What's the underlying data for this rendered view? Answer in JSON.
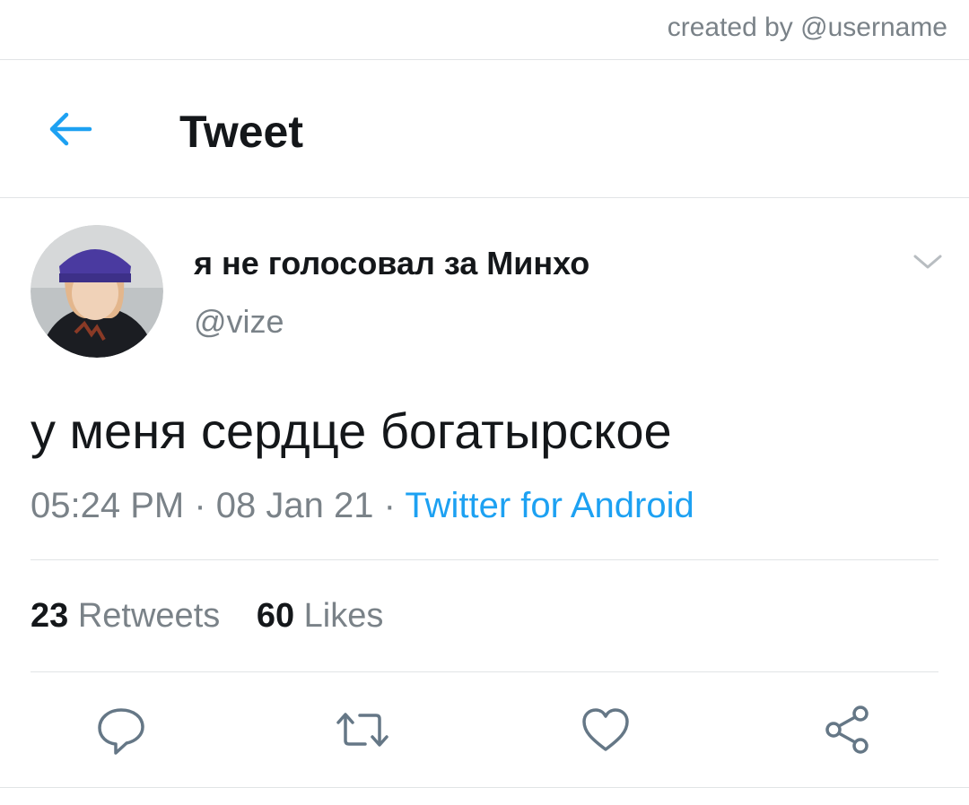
{
  "credit": "created by @username",
  "header": {
    "back_icon": "arrow-left-icon",
    "title": "Tweet"
  },
  "author": {
    "display_name": "я не голосовал за Минхо",
    "handle": "@vize",
    "avatar_icon": "profile-photo"
  },
  "tweet": {
    "text": "у меня сердце богатырское",
    "time": "05:24 PM",
    "separator1": "·",
    "date": "08 Jan 21",
    "separator2": "·",
    "source": "Twitter for Android"
  },
  "stats": {
    "retweets_count": "23",
    "retweets_label": "Retweets",
    "likes_count": "60",
    "likes_label": "Likes"
  },
  "actions": [
    "reply-icon",
    "retweet-icon",
    "like-icon",
    "share-icon"
  ],
  "colors": {
    "accent": "#1da1f2",
    "secondary_text": "#7a8288",
    "divider": "#e1e4e6"
  }
}
